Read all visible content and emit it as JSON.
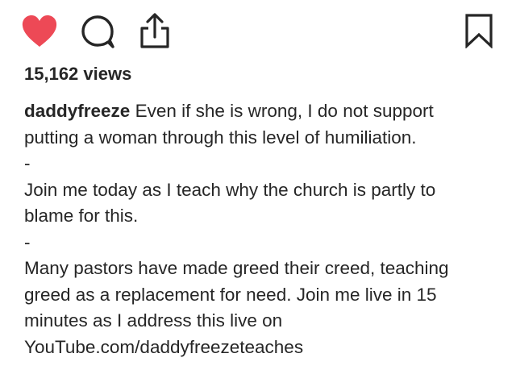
{
  "post": {
    "views": "15,162 views",
    "username": "daddyfreeze",
    "caption_first_line_rest": " Even if she is wrong, I do not support",
    "caption_lines": [
      "putting a woman through this level of humiliation.",
      "-",
      "Join me today as I teach why the church is partly to",
      "blame for this.",
      "-",
      "Many pastors have made greed their creed, teaching",
      "greed as a replacement for need. Join me live in 15",
      "minutes as I address this live on"
    ],
    "link_text": "YouTube.com/daddyfreezeteaches"
  },
  "icons": {
    "like": "heart-icon",
    "comment": "comment-icon",
    "share": "share-icon",
    "save": "bookmark-icon"
  },
  "colors": {
    "like_active": "#ed4956",
    "text": "#262626",
    "background": "#ffffff"
  }
}
